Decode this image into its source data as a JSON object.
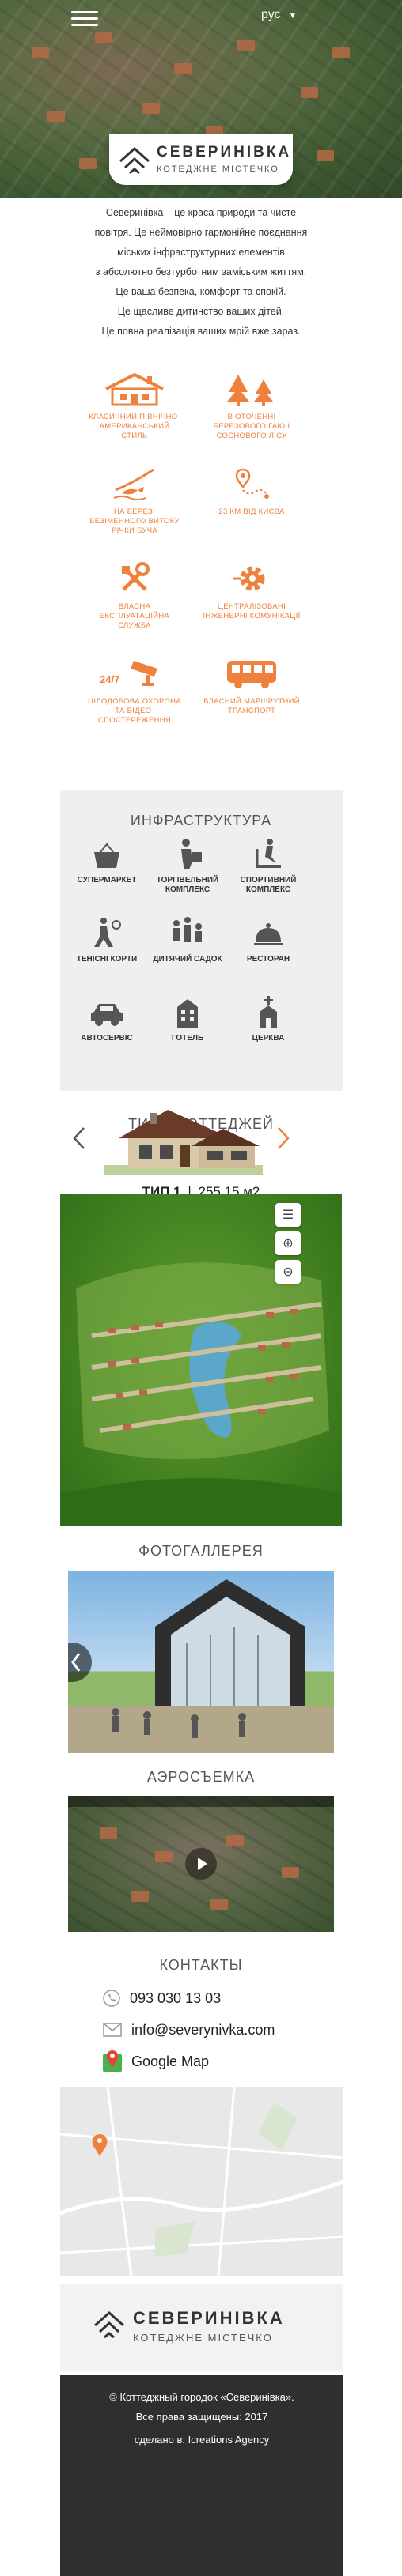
{
  "header": {
    "lang": "рус",
    "brand_title": "СЕВЕРИНІВКА",
    "brand_sub": "КОТЕДЖНЕ МІСТЕЧКО"
  },
  "intro": [
    "Северинівка – це краса природи та чисте",
    "повітря. Це неймовірно гармонійне поєднання",
    "міських інфраструктурних елементів",
    "з абсолютно безтурботним заміським життям.",
    "Це ваша безпека, комфорт та спокій.",
    "Це щасливе дитинство ваших дітей.",
    "Це повна реалізація ваших мрій вже зараз."
  ],
  "features": [
    {
      "label": "КЛАСИЧНИЙ ПІВНІЧНО-АМЕРИКАНСЬКИЙ СТИЛЬ",
      "icon": "house-icon"
    },
    {
      "label": "В ОТОЧЕННІ БЕРЕЗОВОГО ГАЮ І СОСНОВОГО ЛІСУ",
      "icon": "trees-icon"
    },
    {
      "label": "НА БЕРЕЗІ БЕЗІМЕННОГО ВИТОКУ РІЧКИ БУЧА",
      "icon": "fishing-icon"
    },
    {
      "label": "23 КМ ВІД КИЄВА",
      "icon": "map-pin-icon"
    },
    {
      "label": "ВЛАСНА ЕКСПЛУАТАЦІЙНА СЛУЖБА",
      "icon": "tools-icon"
    },
    {
      "label": "ЦЕНТРАЛІЗОВАНІ ІНЖЕНЕРНІ КОМУНІКАЦІЇ",
      "icon": "gear-icon"
    },
    {
      "label": "ЦІЛОДОБОВА ОХОРОНА ТА ВІДЕО-СПОСТЕРЕЖЕННЯ",
      "icon": "camera-icon",
      "badge": "24/7"
    },
    {
      "label": "ВЛАСНИЙ МАРШРУТНИЙ ТРАНСПОРТ",
      "icon": "bus-icon"
    }
  ],
  "infra": {
    "title": "ИНФРАСТРУКТУРА",
    "items": [
      {
        "label": "СУПЕРМАРКЕТ",
        "icon": "basket-icon"
      },
      {
        "label": "ТОРГІВЕЛЬНИЙ КОМПЛЕКС",
        "icon": "shopper-icon"
      },
      {
        "label": "СПОРТИВНИЙ КОМПЛЕКС",
        "icon": "treadmill-icon"
      },
      {
        "label": "ТЕНІСНІ КОРТИ",
        "icon": "tennis-icon"
      },
      {
        "label": "ДИТЯЧИЙ САДОК",
        "icon": "kids-icon"
      },
      {
        "label": "РЕСТОРАН",
        "icon": "cloche-icon"
      },
      {
        "label": "АВТОСЕРВІС",
        "icon": "car-service-icon"
      },
      {
        "label": "ГОТЕЛЬ",
        "icon": "hotel-icon"
      },
      {
        "label": "ЦЕРКВА",
        "icon": "church-icon"
      }
    ]
  },
  "cottages": {
    "title": "ТИПЫ КОТТЕДЖЕЙ",
    "type_label": "ТИП 1",
    "separator": "|",
    "area": "255,15 м2"
  },
  "gallery": {
    "title": "ФОТОГАЛЛЕРЕЯ"
  },
  "aerial": {
    "title": "АЭРОСЪЕМКА"
  },
  "contacts": {
    "title": "КОНТАКТЫ",
    "phone": "093 030 13 03",
    "email": "info@severynivka.com",
    "map": "Google Map"
  },
  "footer": {
    "brand_title": "СЕВЕРИНІВКА",
    "brand_sub": "КОТЕДЖНЕ МІСТЕЧКО",
    "copyright_1": "© Коттеджный городок «Северинівка».",
    "copyright_2": "Все права защищены: 2017",
    "credit": "сделано в: Icreations Agency"
  },
  "colors": {
    "accent": "#f0813d",
    "grey_bg": "#efefef",
    "footer_bg": "#2f2f2f"
  }
}
